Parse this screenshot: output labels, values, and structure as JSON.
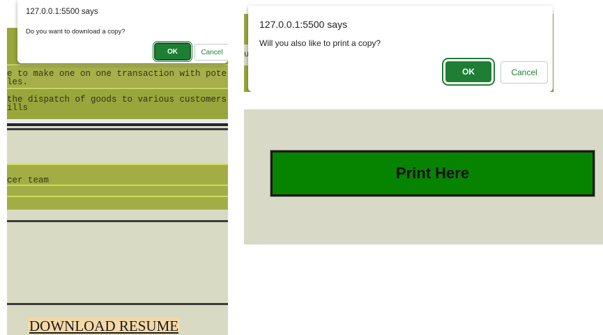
{
  "left_page": {
    "text_lines": [
      "e to make one on one transaction with pote",
      "les.",
      "the dispatch of goods to various customers",
      "ills",
      "cer team"
    ],
    "download_label": "DOWNLOAD RESUME"
  },
  "dialog_download": {
    "title": "127.0.0.1:5500 says",
    "message": "Do you want to download a copy?",
    "ok_label": "OK",
    "cancel_label": "Cancel"
  },
  "dialog_print": {
    "title": "127.0.0.1:5500 says",
    "message": "Will you also like to print a copy?",
    "ok_label": "OK",
    "cancel_label": "Cancel",
    "background_letter": "u"
  },
  "print_panel": {
    "button_label": "Print Here"
  },
  "colors": {
    "accent_green": "#1e7e34",
    "print_button": "#068400",
    "olive": "#9aa840",
    "beige": "#d8dac4"
  }
}
